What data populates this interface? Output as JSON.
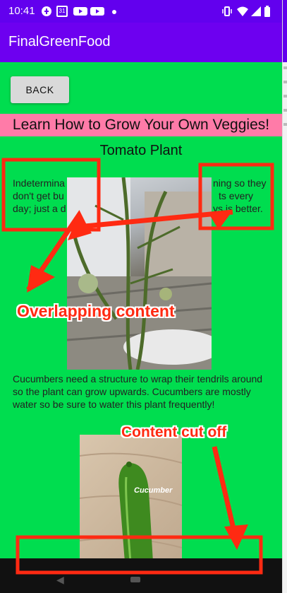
{
  "status_bar": {
    "time": "10:41",
    "icons": [
      "sync-icon",
      "calendar-icon",
      "youtube-icon",
      "youtube-icon",
      "dot-icon"
    ],
    "calendar_day": "31",
    "right_icons": [
      "vibrate-icon",
      "wifi-icon",
      "signal-icon",
      "battery-icon"
    ]
  },
  "app_bar": {
    "title": "FinalGreenFood"
  },
  "content": {
    "back_label": "BACK",
    "heading": "Learn How to Grow Your Own Veggies!",
    "plant_title": "Tomato Plant",
    "tomato_left_line1": "Indetermina",
    "tomato_right_line1": "ning so they",
    "tomato_left_line2": "don't get bu",
    "tomato_right_line2": "ts every",
    "tomato_left_line3": "day; just a d",
    "tomato_right_line3": "ys is better.",
    "cucumber_text": "Cucumbers need a structure to wrap their tendrils around so the plant can grow upwards. Cucumbers are mostly water so be sure to water this plant frequently!",
    "cucumber_image_label": "Cucumber"
  },
  "annotations": {
    "overlap_label": "Overlapping content",
    "cutoff_label": "Content cut off"
  },
  "colors": {
    "status_bar": "#6200ee",
    "app_bar": "#6d00f0",
    "background": "#00dd4f",
    "heading_bg": "#ff7ba8",
    "annotation": "#ff2a12"
  }
}
